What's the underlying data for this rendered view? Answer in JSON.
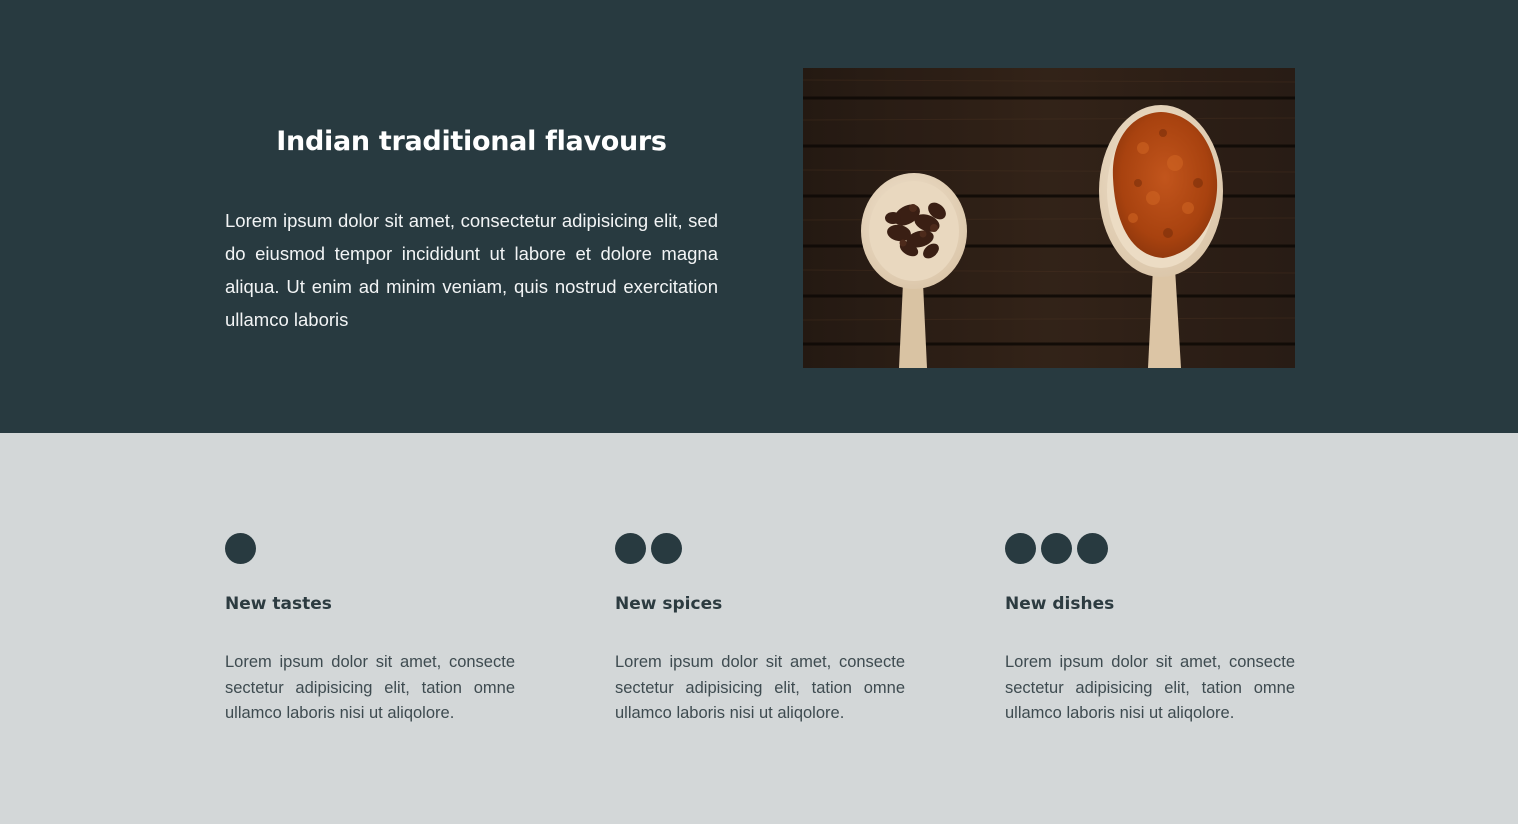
{
  "hero": {
    "title": "Indian traditional flavours",
    "body": "Lorem ipsum dolor sit amet, consectetur adipisicing elit, sed do eiusmod tempor incididunt ut labore et dolore magna aliqua. Ut enim ad minim veniam, quis nostrud exercitation ullamco laboris",
    "image": "spice-spoons-on-wood-photo"
  },
  "features": [
    {
      "dots": 1,
      "title": "New tastes",
      "body": "Lorem ipsum dolor sit amet, consecte sectetur adipisicing elit, tation omne ullamco laboris nisi ut aliqolore."
    },
    {
      "dots": 2,
      "title": "New spices",
      "body": "Lorem ipsum dolor sit amet, consecte sectetur adipisicing elit, tation omne ullamco laboris nisi ut aliqolore."
    },
    {
      "dots": 3,
      "title": "New dishes",
      "body": "Lorem ipsum dolor sit amet, consecte sectetur adipisicing elit, tation omne ullamco laboris nisi ut aliqolore."
    }
  ],
  "colors": {
    "hero_background": "#283a40",
    "features_background": "#d3d7d8",
    "accent": "#283a40"
  }
}
